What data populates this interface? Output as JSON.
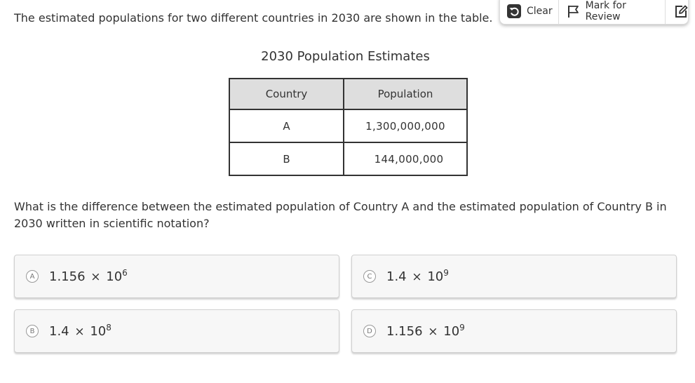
{
  "intro": "The estimated populations for two different countries in 2030 are shown in the table.",
  "toolbar": {
    "clear_label": "Clear",
    "mark_label": "Mark for Review",
    "icons": [
      "undo-icon",
      "flag-icon",
      "edit-icon"
    ]
  },
  "table": {
    "title": "2030 Population Estimates",
    "headers": [
      "Country",
      "Population"
    ],
    "rows": [
      {
        "country": "A",
        "population": "1,300,000,000"
      },
      {
        "country": "B",
        "population": "144,000,000"
      }
    ]
  },
  "question": "What is the difference between the estimated population of Country A and the estimated population of Country B in 2030 written in scientific notation?",
  "choices": {
    "a": {
      "letter": "A",
      "mantissa": "1.156",
      "times": "×",
      "base": "10",
      "exponent": "6"
    },
    "b": {
      "letter": "B",
      "mantissa": "1.4",
      "times": "×",
      "base": "10",
      "exponent": "8"
    },
    "c": {
      "letter": "C",
      "mantissa": "1.4",
      "times": "×",
      "base": "10",
      "exponent": "9"
    },
    "d": {
      "letter": "D",
      "mantissa": "1.156",
      "times": "×",
      "base": "10",
      "exponent": "9"
    }
  }
}
